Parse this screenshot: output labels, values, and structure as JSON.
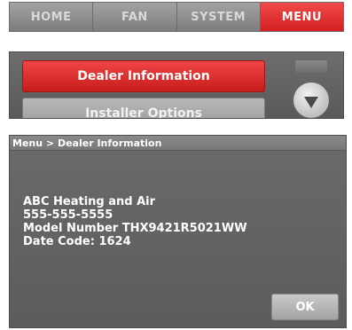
{
  "tabs": [
    {
      "label": "HOME",
      "active": false
    },
    {
      "label": "FAN",
      "active": false
    },
    {
      "label": "SYSTEM",
      "active": false
    },
    {
      "label": "MENU",
      "active": true
    }
  ],
  "menu": {
    "items": [
      {
        "label": "Dealer Information",
        "selected": true
      },
      {
        "label": "Installer Options",
        "selected": false
      }
    ],
    "scroll_down_icon": "triangle-down-icon"
  },
  "detail": {
    "breadcrumb": "Menu > Dealer Information",
    "company": "ABC Heating and Air",
    "phone": "555-555-5555",
    "model": "Model Number THX9421R5021WW",
    "date_code": "Date Code: 1624",
    "ok_label": "OK"
  },
  "colors": {
    "accent_red": "#e02a2a",
    "panel_grey": "#666666"
  }
}
